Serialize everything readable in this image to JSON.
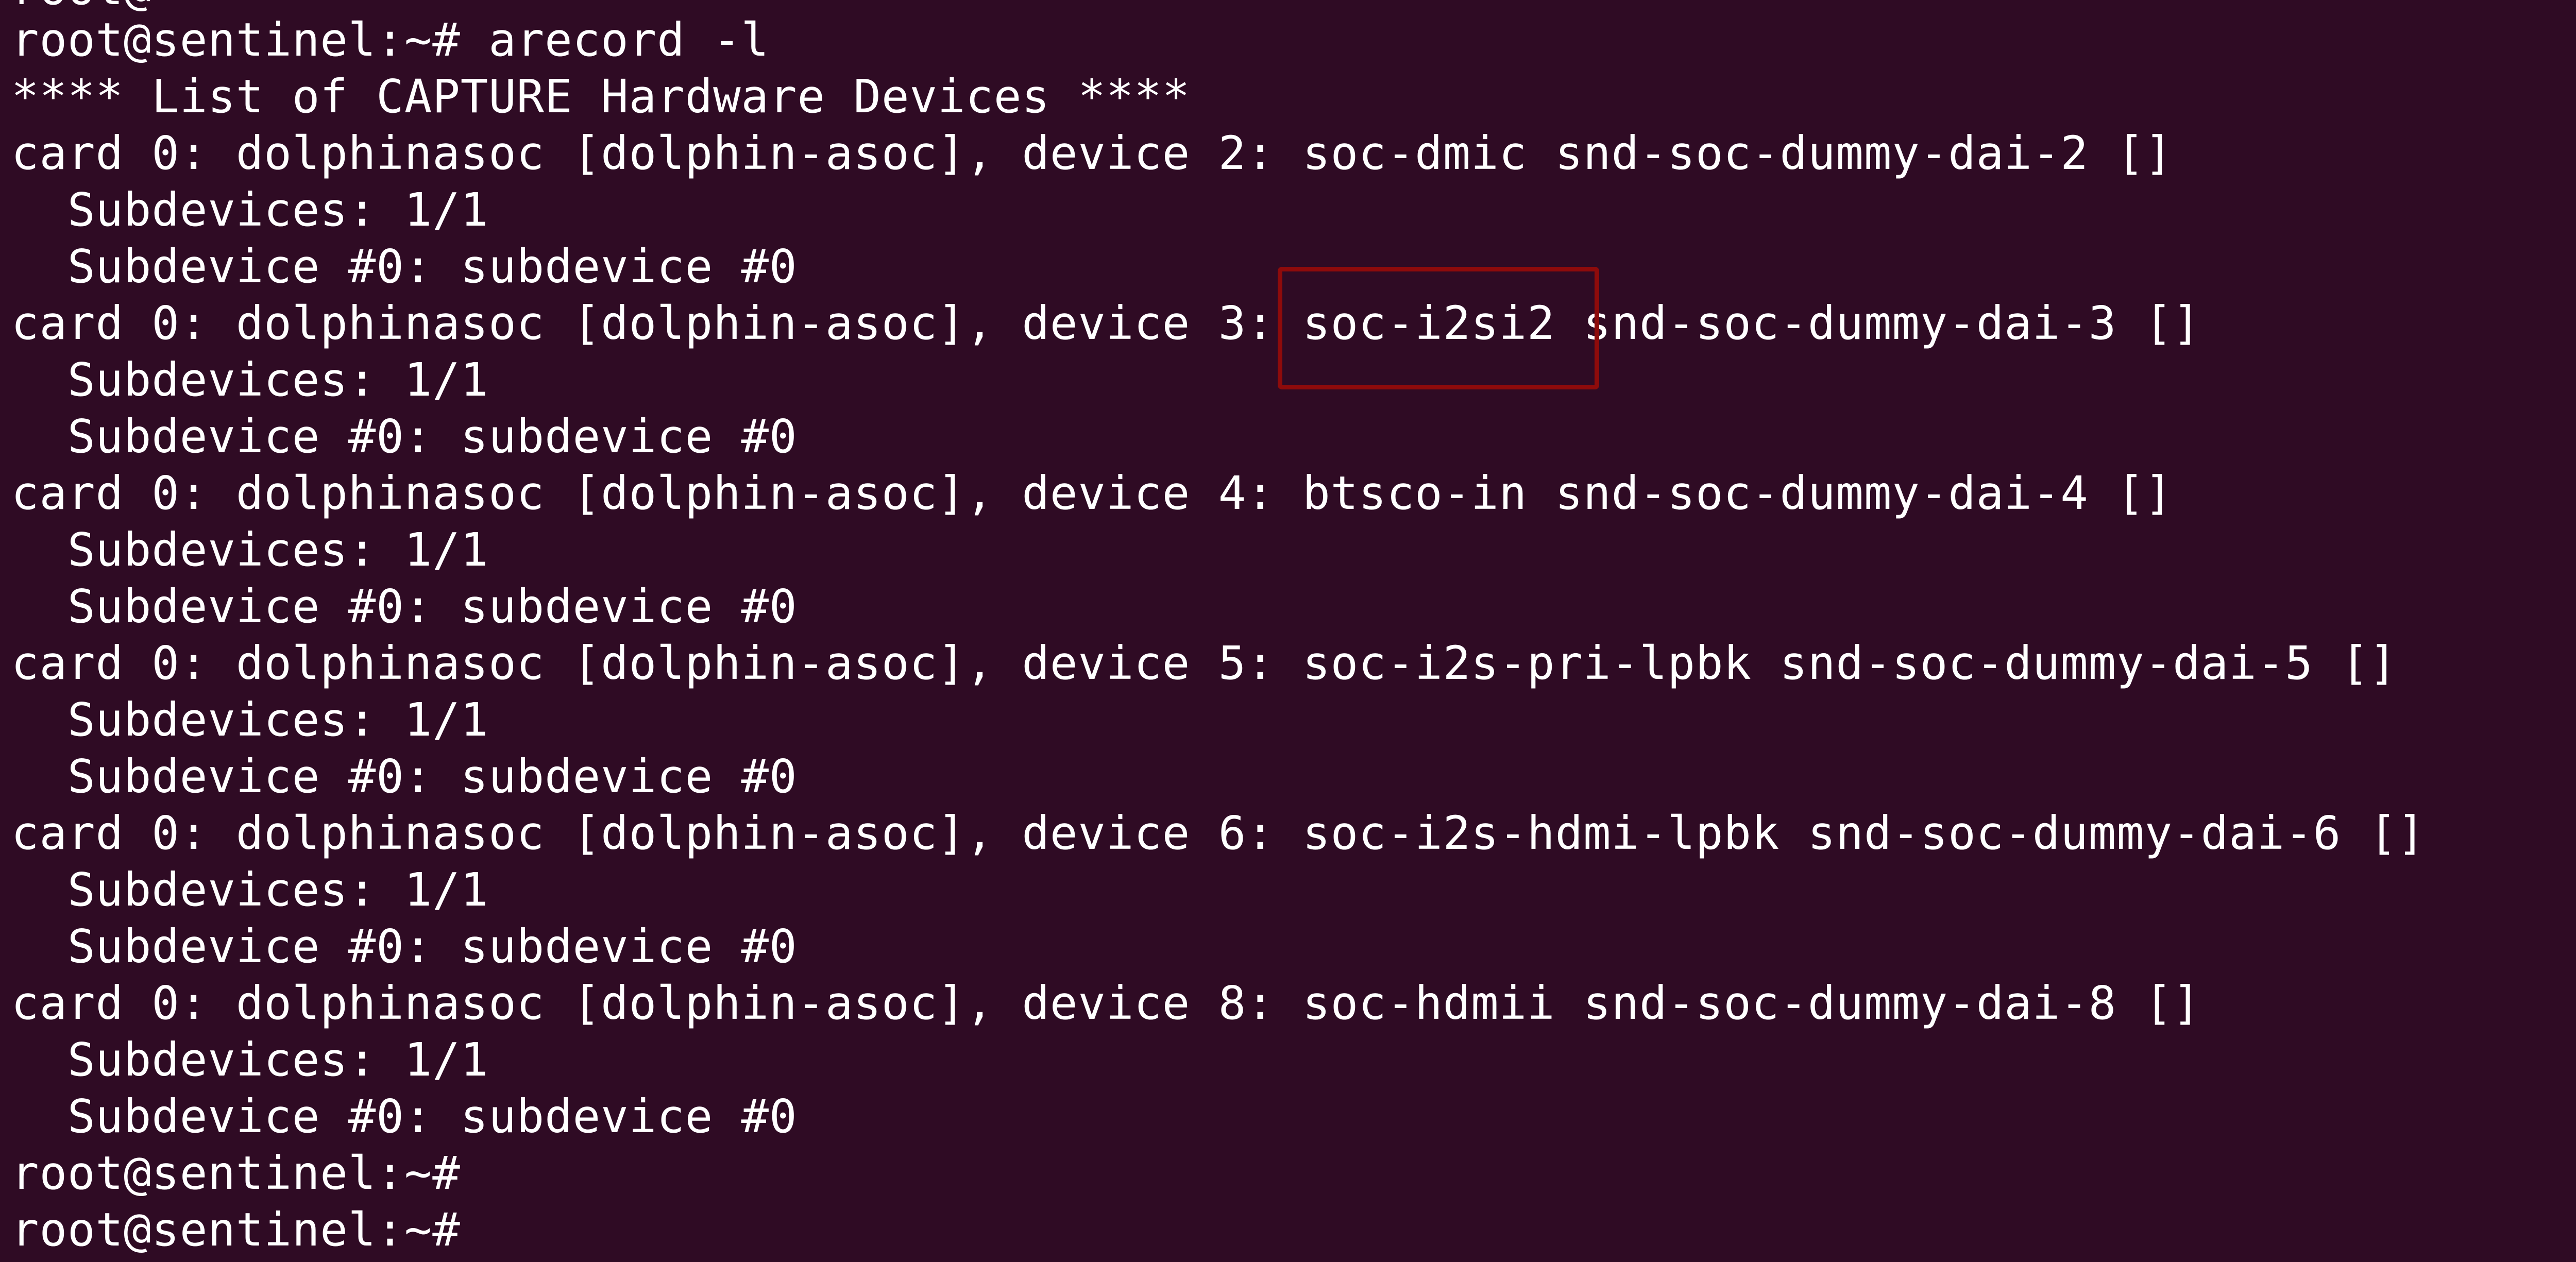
{
  "terminal": {
    "partial_top_line": "root@",
    "lines": [
      "root@sentinel:~# arecord -l",
      "**** List of CAPTURE Hardware Devices ****",
      "card 0: dolphinasoc [dolphin-asoc], device 2: soc-dmic snd-soc-dummy-dai-2 []",
      "  Subdevices: 1/1",
      "  Subdevice #0: subdevice #0",
      "card 0: dolphinasoc [dolphin-asoc], device 3: soc-i2si2 snd-soc-dummy-dai-3 []",
      "  Subdevices: 1/1",
      "  Subdevice #0: subdevice #0",
      "card 0: dolphinasoc [dolphin-asoc], device 4: btsco-in snd-soc-dummy-dai-4 []",
      "  Subdevices: 1/1",
      "  Subdevice #0: subdevice #0",
      "card 0: dolphinasoc [dolphin-asoc], device 5: soc-i2s-pri-lpbk snd-soc-dummy-dai-5 []",
      "  Subdevices: 1/1",
      "  Subdevice #0: subdevice #0",
      "card 0: dolphinasoc [dolphin-asoc], device 6: soc-i2s-hdmi-lpbk snd-soc-dummy-dai-6 []",
      "  Subdevices: 1/1",
      "  Subdevice #0: subdevice #0",
      "card 0: dolphinasoc [dolphin-asoc], device 8: soc-hdmii snd-soc-dummy-dai-8 []",
      "  Subdevices: 1/1",
      "  Subdevice #0: subdevice #0",
      "root@sentinel:~#",
      "root@sentinel:~#"
    ],
    "highlight": {
      "text": "soc-i2si2",
      "color": "#8e0b0b"
    },
    "colors": {
      "background": "#2f0b24",
      "foreground": "#ffffff"
    }
  }
}
